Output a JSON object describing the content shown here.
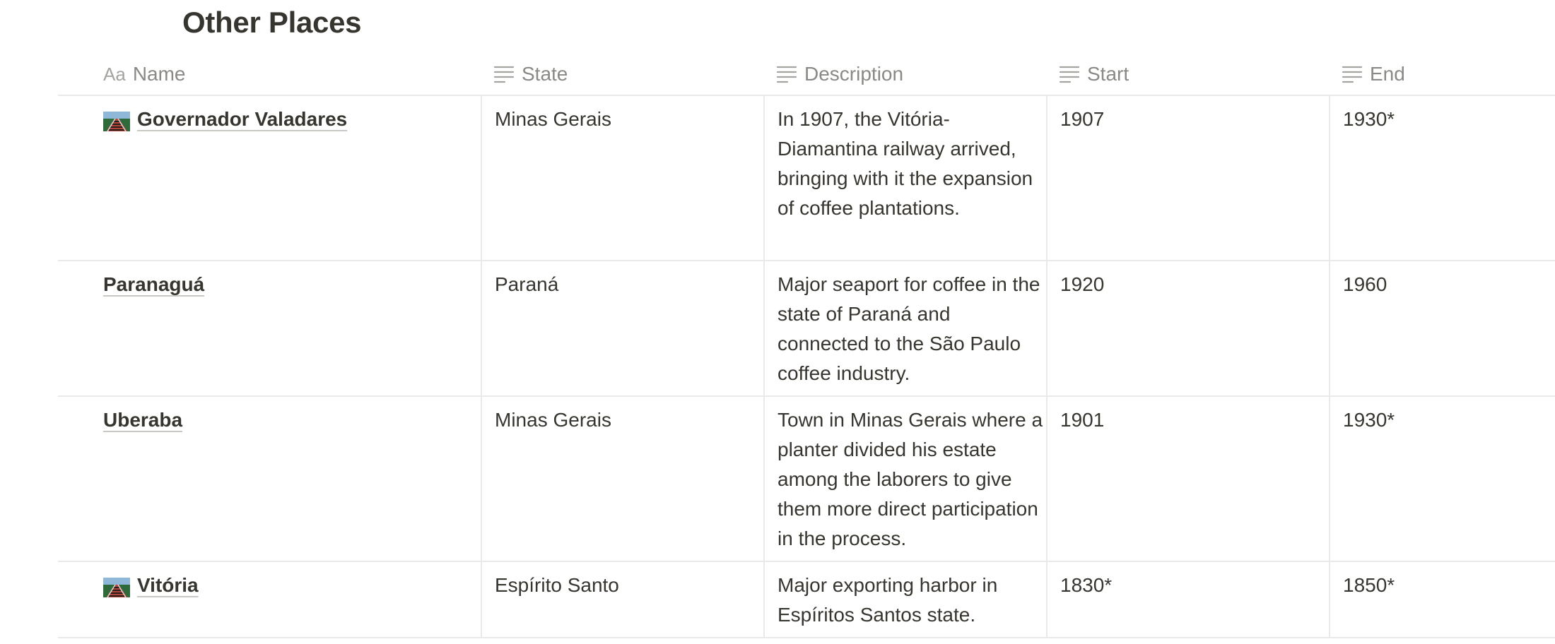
{
  "database": {
    "title": "Other Places"
  },
  "columns": {
    "name": {
      "label": "Name",
      "icon": "Aa"
    },
    "state": {
      "label": "State",
      "icon": "text-lines-icon"
    },
    "description": {
      "label": "Description",
      "icon": "text-lines-icon"
    },
    "start": {
      "label": "Start",
      "icon": "text-lines-icon"
    },
    "end": {
      "label": "End",
      "icon": "text-lines-icon"
    }
  },
  "rows": [
    {
      "name": "Governador Valadares",
      "has_icon": true,
      "icon": "railway-icon",
      "state": "Minas Gerais",
      "description": "In 1907, the Vitória-Diamantina railway arrived, bringing with it the expansion of coffee plantations.",
      "start": "1907",
      "end": "1930*"
    },
    {
      "name": "Paranaguá",
      "has_icon": false,
      "state": "Paraná",
      "description": "Major seaport for coffee in the state of Paraná and connected to the São Paulo coffee industry.",
      "start": "1920",
      "end": "1960"
    },
    {
      "name": "Uberaba",
      "has_icon": false,
      "state": "Minas Gerais",
      "description": "Town in Minas Gerais where a planter divided his estate among the laborers to give them more direct participation in the process.",
      "start": "1901",
      "end": "1930*"
    },
    {
      "name": "Vitória",
      "has_icon": true,
      "icon": "railway-icon",
      "state": "Espírito Santo",
      "description": "Major exporting harbor in Espíritos Santos state.",
      "start": "1830*",
      "end": "1850*"
    }
  ],
  "colors": {
    "text": "#37352f",
    "header_text": "#8a8985",
    "border": "#e9e9e7"
  }
}
